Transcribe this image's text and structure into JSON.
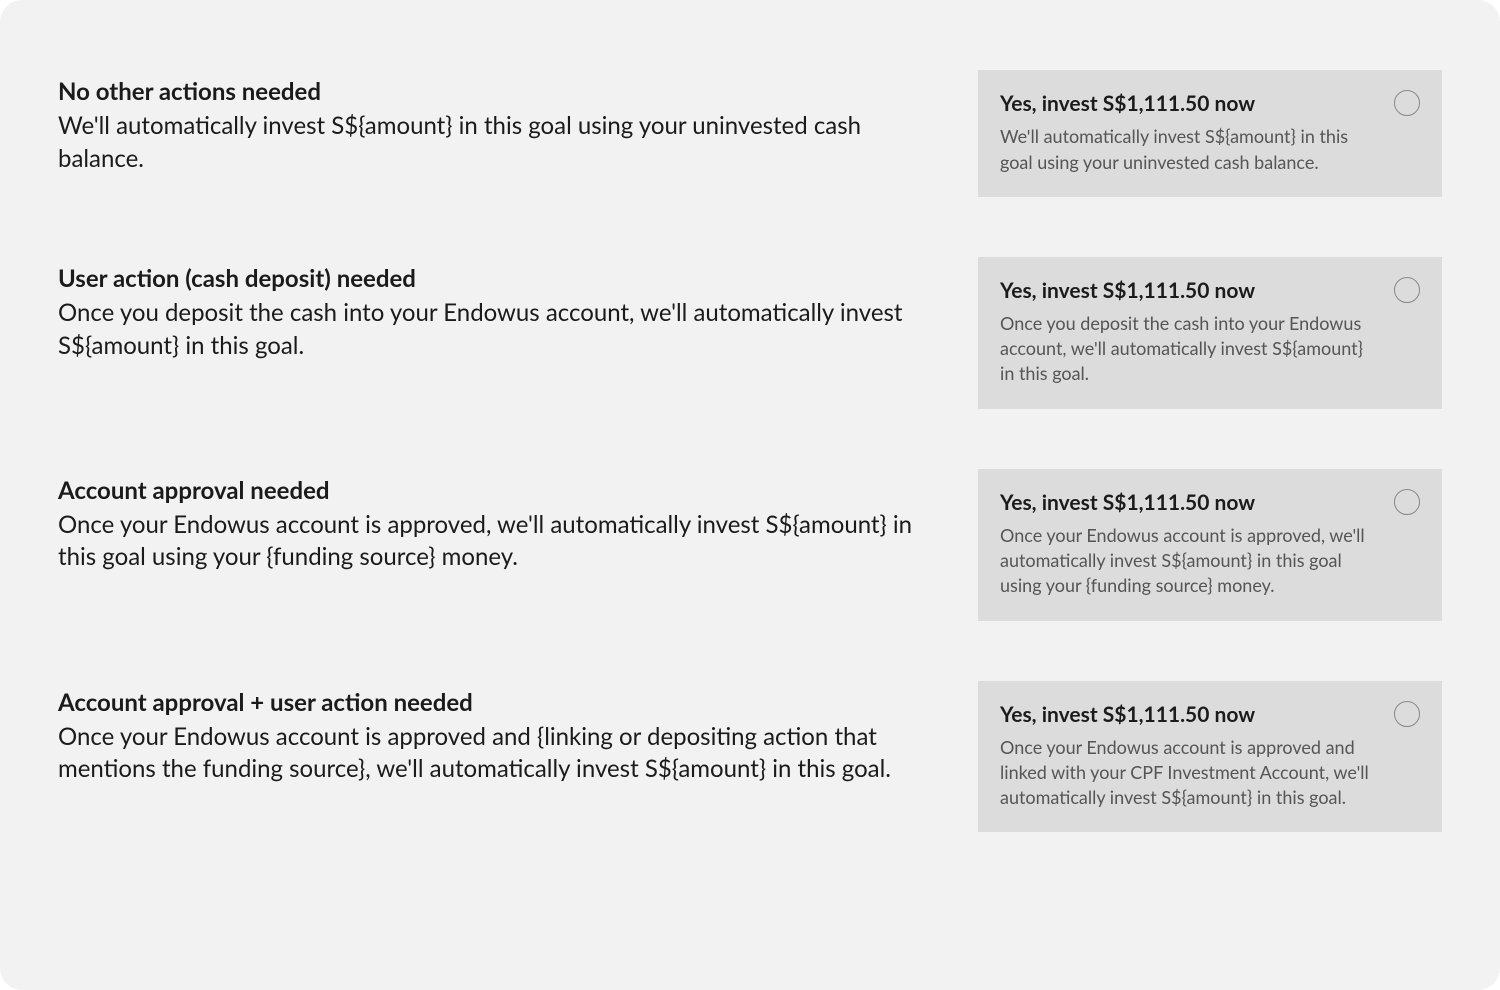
{
  "rows": [
    {
      "left_title": "No other actions needed",
      "left_body": "We'll automatically invest S${amount} in this goal using your uninvested cash balance.",
      "card_title": "Yes, invest S$1,111.50 now",
      "card_body": "We'll automatically invest S${amount} in this goal using your uninvested cash balance."
    },
    {
      "left_title": "User action (cash deposit) needed",
      "left_body": "Once you deposit the cash into your Endowus account, we'll automatically invest S${amount} in this goal.",
      "card_title": "Yes, invest S$1,111.50 now",
      "card_body": "Once you deposit the cash into your Endowus account, we'll automatically invest S${amount} in this goal."
    },
    {
      "left_title": "Account approval needed",
      "left_body": "Once your Endowus account is approved, we'll automatically invest S${amount} in this goal using your {funding source} money.",
      "card_title": "Yes, invest S$1,111.50 now",
      "card_body": "Once your Endowus account is approved, we'll automatically invest S${amount} in this goal using your {funding source} money."
    },
    {
      "left_title": "Account approval + user action needed",
      "left_body": "Once your Endowus account is approved and {linking or depositing action that mentions the funding source}, we'll automatically invest S${amount} in this goal.",
      "card_title": "Yes, invest S$1,111.50 now",
      "card_body": "Once your Endowus account is approved and linked with your CPF Investment Account, we'll automatically invest S${amount} in this goal."
    }
  ]
}
